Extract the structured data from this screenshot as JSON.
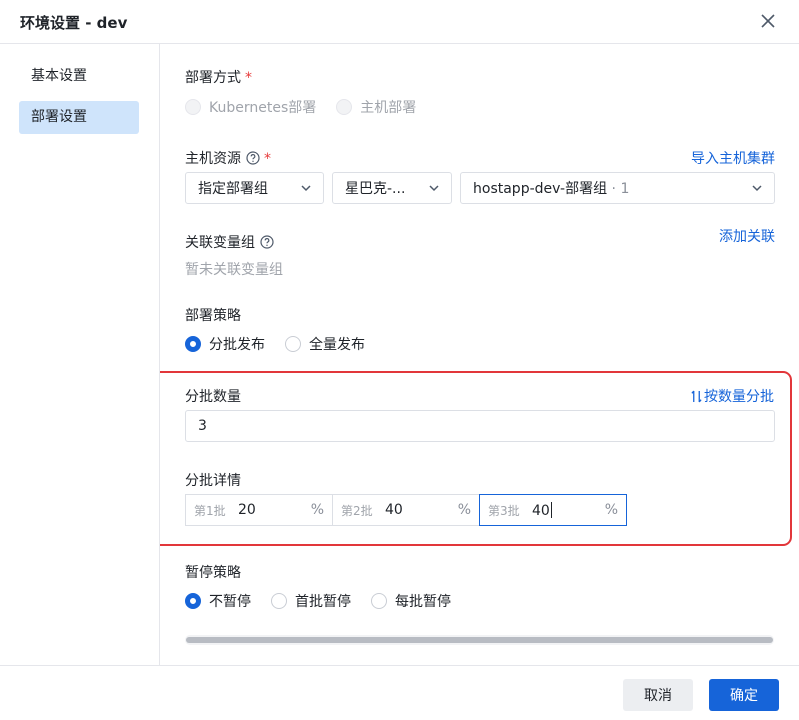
{
  "dialog": {
    "title": "环境设置 - dev"
  },
  "sidebar": {
    "items": [
      {
        "label": "基本设置"
      },
      {
        "label": "部署设置"
      }
    ]
  },
  "deploy_method": {
    "label": "部署方式",
    "required_mark": "*",
    "options": [
      {
        "label": "Kubernetes部署"
      },
      {
        "label": "主机部署"
      }
    ]
  },
  "host_resource": {
    "label": "主机资源",
    "required_mark": "*",
    "import_link": "导入主机集群",
    "select1": "指定部署组",
    "select2": "星巴克-...",
    "select3": "hostapp-dev-部署组",
    "select3_count": " · 1"
  },
  "var_group": {
    "label": "关联变量组",
    "add_link": "添加关联",
    "empty_text": "暂未关联变量组"
  },
  "strategy": {
    "label": "部署策略",
    "options": [
      {
        "label": "分批发布"
      },
      {
        "label": "全量发布"
      }
    ]
  },
  "batch_count": {
    "label": "分批数量",
    "toggle_link": "按数量分批",
    "value": "3"
  },
  "batch_detail": {
    "label": "分批详情",
    "unit": "%",
    "batches": [
      {
        "prefix": "第1批",
        "value": "20"
      },
      {
        "prefix": "第2批",
        "value": "40"
      },
      {
        "prefix": "第3批",
        "value": "40"
      }
    ]
  },
  "pause": {
    "label": "暂停策略",
    "options": [
      {
        "label": "不暂停"
      },
      {
        "label": "首批暂停"
      },
      {
        "label": "每批暂停"
      }
    ]
  },
  "footer": {
    "cancel_label": "取消",
    "ok_label": "确定"
  }
}
